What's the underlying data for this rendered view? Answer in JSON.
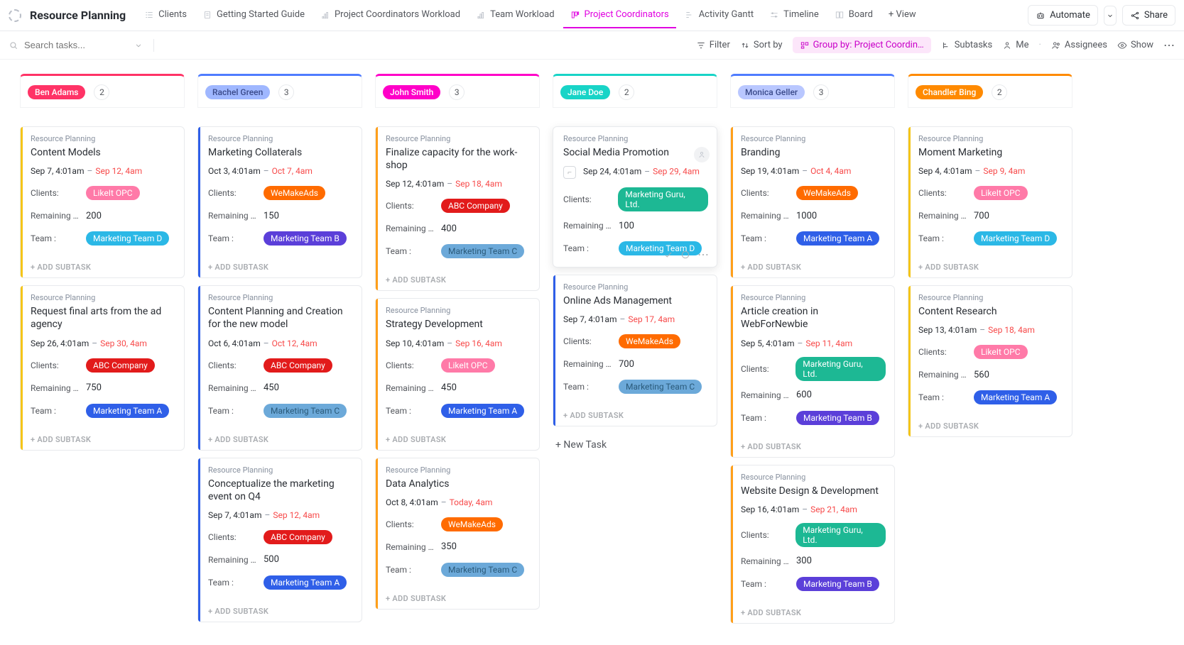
{
  "title": "Resource Planning",
  "tabs": [
    {
      "label": "Clients",
      "icon": "list"
    },
    {
      "label": "Getting Started Guide",
      "icon": "doc"
    },
    {
      "label": "Project Coordinators Workload",
      "icon": "workload"
    },
    {
      "label": "Team Workload",
      "icon": "workload"
    },
    {
      "label": "Project Coordinators",
      "icon": "board",
      "active": true
    },
    {
      "label": "Activity Gantt",
      "icon": "gantt"
    },
    {
      "label": "Timeline",
      "icon": "timeline"
    },
    {
      "label": "Board",
      "icon": "board2"
    },
    {
      "label": "+  View",
      "icon": ""
    }
  ],
  "topButtons": {
    "automate": "Automate",
    "share": "Share"
  },
  "search": {
    "placeholder": "Search tasks..."
  },
  "toolbar": {
    "filter": "Filter",
    "sort": "Sort by",
    "group": "Group by: Project Coordin…",
    "subtasks": "Subtasks",
    "me": "Me",
    "assignees": "Assignees",
    "show": "Show"
  },
  "labels": {
    "crumb": "Resource Planning",
    "clients": "Clients:",
    "remaining": "Remaining …",
    "team": "Team :",
    "addSubtask": "+ ADD SUBTASK",
    "newTask": "+ New Task"
  },
  "clientColors": {
    "LikeIt OPC": "#ff7aa8",
    "WeMakeAds": "#ff6b00",
    "ABC Company": "#e21b1b",
    "Marketing Guru, Ltd.": "#1db894"
  },
  "teamColors": {
    "Marketing Team A": "#2f5fe8",
    "Marketing Team B": "#5b3fd9",
    "Marketing Team C": "#6ca9d9",
    "Marketing Team D": "#2bb8e6"
  },
  "columns": [
    {
      "name": "Ben Adams",
      "chipColor": "#ff3366",
      "borderColor": "#ff3366",
      "count": 2,
      "cards": [
        {
          "stripe": "#f5c518",
          "title": "Content Models",
          "start": "Sep 7, 4:01am",
          "end": "Sep 12, 4am",
          "client": "LikeIt OPC",
          "remaining": "200",
          "team": "Marketing Team D"
        },
        {
          "stripe": "#f5c518",
          "title": "Request final arts from the ad agency",
          "start": "Sep 26, 4:01am",
          "end": "Sep 30, 4am",
          "client": "ABC Company",
          "remaining": "750",
          "team": "Marketing Team A"
        }
      ]
    },
    {
      "name": "Rachel Green",
      "chipColor": "#9fb7ff",
      "borderColor": "#4f7cff",
      "count": 3,
      "chipText": "#3a4a8a",
      "cards": [
        {
          "stripe": "#2f5fe8",
          "title": "Marketing Collaterals",
          "start": "Oct 3, 4:01am",
          "end": "Oct 7, 4am",
          "client": "WeMakeAds",
          "remaining": "150",
          "team": "Marketing Team B"
        },
        {
          "stripe": "#2f5fe8",
          "title": "Content Planning and Creation for the new model",
          "start": "Oct 6, 4:01am",
          "end": "Oct 12, 4am",
          "client": "ABC Company",
          "remaining": "450",
          "team": "Marketing Team C"
        },
        {
          "stripe": "#2f5fe8",
          "title": "Conceptualize the marketing event on Q4",
          "start": "Sep 7, 4:01am",
          "end": "Sep 12, 4am",
          "client": "ABC Company",
          "remaining": "500",
          "team": "Marketing Team A"
        }
      ]
    },
    {
      "name": "John Smith",
      "chipColor": "#ff00c8",
      "borderColor": "#ff00c8",
      "count": 3,
      "cards": [
        {
          "stripe": "#ff9f1a",
          "title": "Finalize capacity for the work­shop",
          "start": "Sep 12, 4:01am",
          "end": "Sep 18, 4am",
          "client": "ABC Company",
          "remaining": "400",
          "team": "Marketing Team C"
        },
        {
          "stripe": "#ff9f1a",
          "title": "Strategy Development",
          "start": "Sep 10, 4:01am",
          "end": "Sep 16, 4am",
          "client": "LikeIt OPC",
          "remaining": "450",
          "team": "Marketing Team A"
        },
        {
          "stripe": "#ff9f1a",
          "title": "Data Analytics",
          "start": "Oct 8, 4:01am",
          "end": "Today, 4am",
          "client": "WeMakeAds",
          "remaining": "350",
          "team": "Marketing Team C"
        }
      ]
    },
    {
      "name": "Jane Doe",
      "chipColor": "#18d4c7",
      "borderColor": "#18d4c7",
      "count": 2,
      "cards": [
        {
          "stripe": "",
          "title": "Social Media Promotion",
          "start": "Sep 24, 4:01am",
          "end": "Sep 29, 4am",
          "client": "Marketing Guru, Ltd.",
          "remaining": "100",
          "team": "Marketing Team D",
          "hovered": true,
          "subtaskIcon": true
        },
        {
          "stripe": "#2f5fe8",
          "title": "Online Ads Management",
          "start": "Sep 7, 4:01am",
          "end": "Sep 17, 4am",
          "client": "WeMakeAds",
          "remaining": "700",
          "team": "Marketing Team C"
        }
      ],
      "showNewTask": true
    },
    {
      "name": "Monica Geller",
      "chipColor": "#b9c7ff",
      "borderColor": "#4f7cff",
      "count": 3,
      "chipText": "#3a4a8a",
      "cards": [
        {
          "stripe": "#ff9f1a",
          "title": "Branding",
          "start": "Sep 19, 4:01am",
          "end": "Oct 4, 4am",
          "client": "WeMakeAds",
          "remaining": "1000",
          "team": "Marketing Team A"
        },
        {
          "stripe": "#ff9f1a",
          "title": "Article creation in WebForNewbie",
          "start": "Sep 5, 4:01am",
          "end": "Sep 11, 4am",
          "client": "Marketing Guru, Ltd.",
          "remaining": "600",
          "team": "Marketing Team B"
        },
        {
          "stripe": "#ff9f1a",
          "title": "Website Design & Development",
          "start": "Sep 16, 4:01am",
          "end": "Sep 21, 4am",
          "client": "Marketing Guru, Ltd.",
          "remaining": "300",
          "team": "Marketing Team B"
        }
      ]
    },
    {
      "name": "Chandler Bing",
      "chipColor": "#ff8a00",
      "borderColor": "#ff8a00",
      "count": 2,
      "cards": [
        {
          "stripe": "#f5c518",
          "title": "Moment Marketing",
          "start": "Sep 4, 4:01am",
          "end": "Sep 9, 4am",
          "client": "LikeIt OPC",
          "remaining": "700",
          "team": "Marketing Team D"
        },
        {
          "stripe": "#f5c518",
          "title": "Content Research",
          "start": "Sep 13, 4:01am",
          "end": "Sep 18, 4am",
          "client": "LikeIt OPC",
          "remaining": "560",
          "team": "Marketing Team A"
        }
      ]
    }
  ]
}
